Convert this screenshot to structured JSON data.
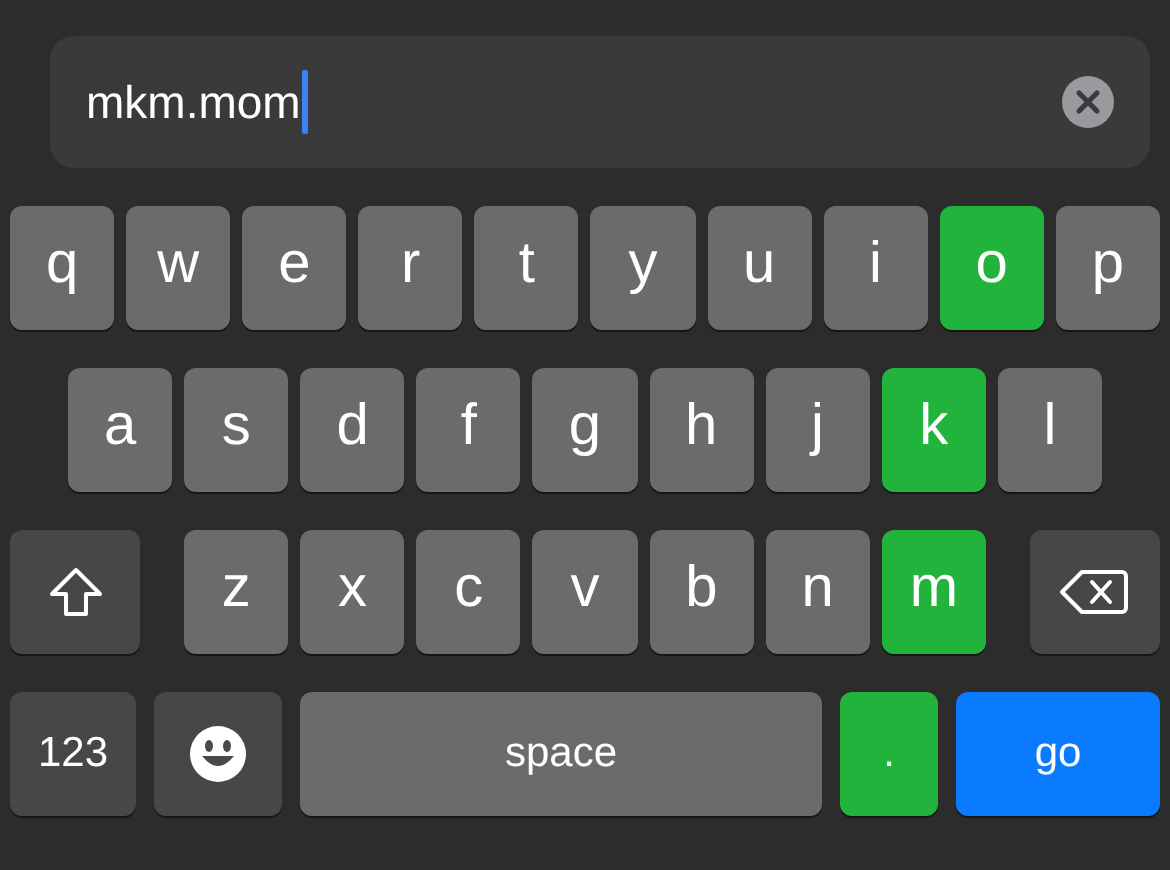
{
  "address_field": {
    "value": "mkm.mom",
    "focused": true
  },
  "keyboard_rows": [
    {
      "keys": [
        {
          "kind": "letter",
          "label": "q",
          "highlighted": false
        },
        {
          "kind": "letter",
          "label": "w",
          "highlighted": false
        },
        {
          "kind": "letter",
          "label": "e",
          "highlighted": false
        },
        {
          "kind": "letter",
          "label": "r",
          "highlighted": false
        },
        {
          "kind": "letter",
          "label": "t",
          "highlighted": false
        },
        {
          "kind": "letter",
          "label": "y",
          "highlighted": false
        },
        {
          "kind": "letter",
          "label": "u",
          "highlighted": false
        },
        {
          "kind": "letter",
          "label": "i",
          "highlighted": false
        },
        {
          "kind": "letter",
          "label": "o",
          "highlighted": true
        },
        {
          "kind": "letter",
          "label": "p",
          "highlighted": false
        }
      ]
    },
    {
      "keys": [
        {
          "kind": "letter",
          "label": "a",
          "highlighted": false
        },
        {
          "kind": "letter",
          "label": "s",
          "highlighted": false
        },
        {
          "kind": "letter",
          "label": "d",
          "highlighted": false
        },
        {
          "kind": "letter",
          "label": "f",
          "highlighted": false
        },
        {
          "kind": "letter",
          "label": "g",
          "highlighted": false
        },
        {
          "kind": "letter",
          "label": "h",
          "highlighted": false
        },
        {
          "kind": "letter",
          "label": "j",
          "highlighted": false
        },
        {
          "kind": "letter",
          "label": "k",
          "highlighted": true
        },
        {
          "kind": "letter",
          "label": "l",
          "highlighted": false
        }
      ]
    },
    {
      "keys": [
        {
          "kind": "shift",
          "highlighted": false
        },
        {
          "kind": "letter",
          "label": "z",
          "highlighted": false
        },
        {
          "kind": "letter",
          "label": "x",
          "highlighted": false
        },
        {
          "kind": "letter",
          "label": "c",
          "highlighted": false
        },
        {
          "kind": "letter",
          "label": "v",
          "highlighted": false
        },
        {
          "kind": "letter",
          "label": "b",
          "highlighted": false
        },
        {
          "kind": "letter",
          "label": "n",
          "highlighted": false
        },
        {
          "kind": "letter",
          "label": "m",
          "highlighted": true
        },
        {
          "kind": "backspace",
          "highlighted": false
        }
      ]
    },
    {
      "keys": [
        {
          "kind": "numbers",
          "label": "123",
          "highlighted": false
        },
        {
          "kind": "emoji",
          "highlighted": false
        },
        {
          "kind": "space",
          "label": "space",
          "highlighted": false
        },
        {
          "kind": "period",
          "label": ".",
          "highlighted": true
        },
        {
          "kind": "go",
          "label": "go",
          "highlighted": false
        }
      ]
    }
  ]
}
